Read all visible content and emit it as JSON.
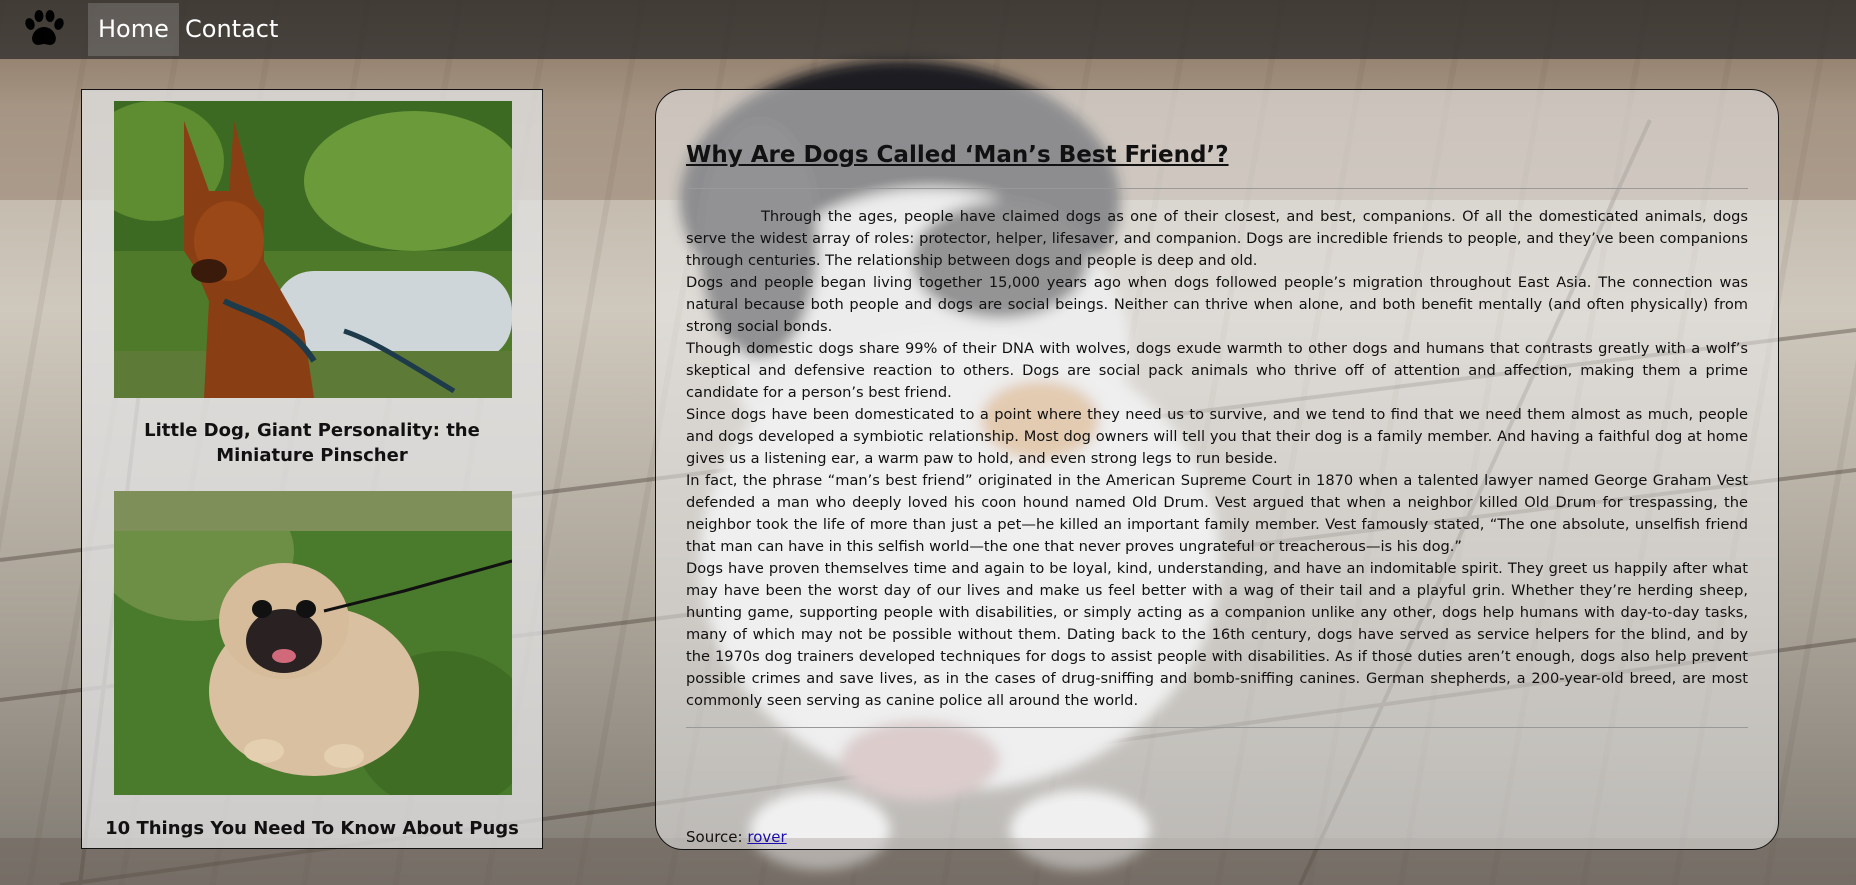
{
  "nav": {
    "logo_icon": "paw-icon",
    "home_label": "Home",
    "contact_label": "Contact"
  },
  "sidebar": {
    "cards": [
      {
        "title": "Little Dog, Giant Personality: the Miniature Pinscher",
        "image": "miniature-pinscher-photo"
      },
      {
        "title": "10 Things You Need To Know About Pugs",
        "image": "pug-photo"
      }
    ]
  },
  "article": {
    "title": "Why Are Dogs Called ‘Man’s Best Friend’?",
    "paragraphs": [
      "Through the ages, people have claimed dogs as one of their closest, and best, companions. Of all the domesticated animals, dogs serve the widest array of roles: protector, helper, lifesaver, and companion. Dogs are incredible friends to people, and they’ve been companions through centuries. The relationship between dogs and people is deep and old.",
      "Dogs and people began living together 15,000 years ago when dogs followed people’s migration throughout East Asia. The connection was natural because both people and dogs are social beings. Neither can thrive when alone, and both benefit mentally (and often physically) from strong social bonds.",
      "Though domestic dogs share 99% of their DNA with wolves, dogs exude warmth to other dogs and humans that contrasts greatly with a wolf’s skeptical and defensive reaction to others. Dogs are social pack animals who thrive off of attention and affection, making them a prime candidate for a person’s best friend.",
      "Since dogs have been domesticated to a point where they need us to survive, and we tend to find that we need them almost as much, people and dogs developed a symbiotic relationship. Most dog owners will tell you that their dog is a family member. And having a faithful dog at home gives us a listening ear, a warm paw to hold, and even strong legs to run beside.",
      "In fact, the phrase “man’s best friend” originated in the American Supreme Court in 1870 when a talented lawyer named George Graham Vest defended a man who deeply loved his coon hound named Old Drum. Vest argued that when a neighbor killed Old Drum for trespassing, the neighbor took the life of more than just a pet—he killed an important family member. Vest famously stated, “The one absolute, unselfish friend that man can have in this selfish world—the one that never proves ungrateful or treacherous—is his dog.”",
      "Dogs have proven themselves time and again to be loyal, kind, understanding, and have an indomitable spirit. They greet us happily after what may have been the worst day of our lives and make us feel better with a wag of their tail and a playful grin. Whether they’re herding sheep, hunting game, supporting people with disabilities, or simply acting as a companion unlike any other, dogs help humans with day-to-day tasks, many of which may not be possible without them. Dating back to the 16th century, dogs have served as service helpers for the blind, and by the 1970s dog trainers developed techniques for dogs to assist people with disabilities. As if those duties aren’t enough, dogs also help prevent possible crimes and save lives, as in the cases of drug-sniffing and bomb-sniffing canines. German shepherds, a 200-year-old breed, are most commonly seen serving as canine police all around the world."
    ],
    "source_label": "Source:",
    "source_link": "rover"
  },
  "background_image": "puppy-on-wooden-deck-photo"
}
